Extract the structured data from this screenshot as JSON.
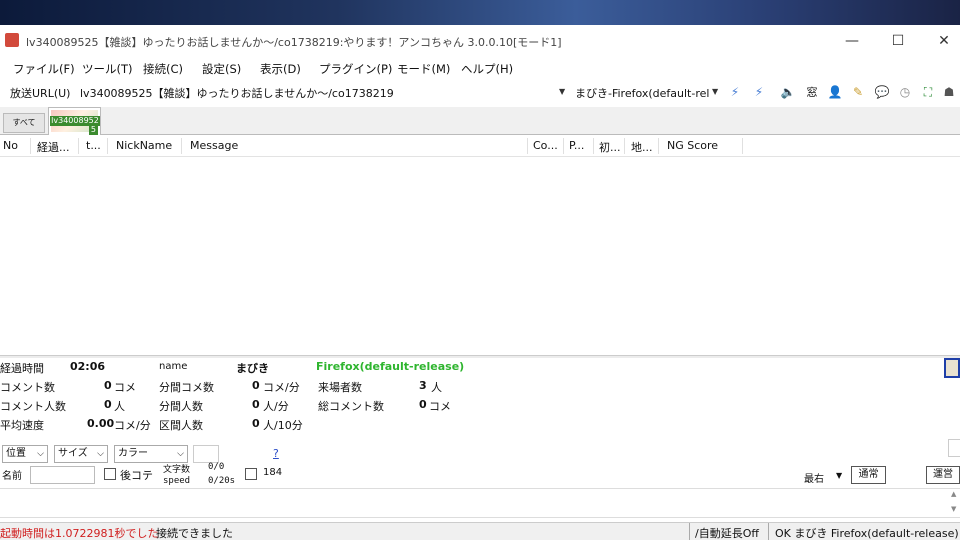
{
  "window": {
    "title": "lv340089525【雑談】ゆったりお話しませんか〜/co1738219:やります！アンコちゃん 3.0.0.10[モード1]",
    "minimize": "—",
    "maximize": "☐",
    "close": "✕"
  },
  "menu": [
    "ファイル(F)",
    "ツール(T)",
    "接続(C)",
    "設定(S)",
    "表示(D)",
    "プラグイン(P)",
    "モード(M)",
    "ヘルプ(H)"
  ],
  "url_bar": {
    "label": "放送URL(U)",
    "value": "lv340089525【雑談】ゆったりお話しませんか〜/co1738219",
    "browser": "まびき-Firefox(default-rel"
  },
  "tabs": {
    "all": "すべて",
    "live_id": "lv34008952",
    "live_num": "5"
  },
  "columns": [
    "No",
    "経過...",
    "t...",
    "NickName",
    "Message",
    "Co...",
    "P...",
    "初...",
    "地...",
    "NG Score"
  ],
  "stats": {
    "elapsed_label": "経過時間",
    "elapsed_value": "02:06",
    "name_label": "name",
    "name_value": "まびき",
    "browser_value": "Firefox(default-release)",
    "comment_count_label": "コメント数",
    "comment_count_value": "0",
    "comment_count_unit": "コメ",
    "per_min_comments_label": "分間コメ数",
    "per_min_comments_value": "0",
    "per_min_comments_unit": "コメ/分",
    "visitors_label": "来場者数",
    "visitors_value": "3",
    "visitors_unit": "人",
    "commenters_label": "コメント人数",
    "commenters_value": "0",
    "commenters_unit": "人",
    "per_min_people_label": "分間人数",
    "per_min_people_value": "0",
    "per_min_people_unit": "人/分",
    "total_comments_label": "総コメント数",
    "total_comments_value": "0",
    "total_comments_unit": "コメ",
    "avg_speed_label": "平均速度",
    "avg_speed_value": "0.00",
    "avg_speed_unit": "コメ/分",
    "section_people_label": "区間人数",
    "section_people_value": "0",
    "section_people_unit": "人/10分"
  },
  "controls": {
    "position": "位置",
    "size": "サイズ",
    "color": "カラー",
    "help": "?",
    "name_label": "名前",
    "kotehan_label": "後コテ",
    "char_count_label": "文字数",
    "char_count_value": "0/0",
    "speed_label": "speed",
    "speed_value": "0/20s",
    "count_184": "184",
    "right_select": "最右",
    "normal_button": "通常",
    "admin_button": "運営"
  },
  "statusbar": {
    "startup": "起動時間は1.0722981秒でした",
    "connected": "接続できました",
    "auto_extend": "/自動延長Off",
    "ok_status": "OK まびき Firefox(default-release)"
  }
}
